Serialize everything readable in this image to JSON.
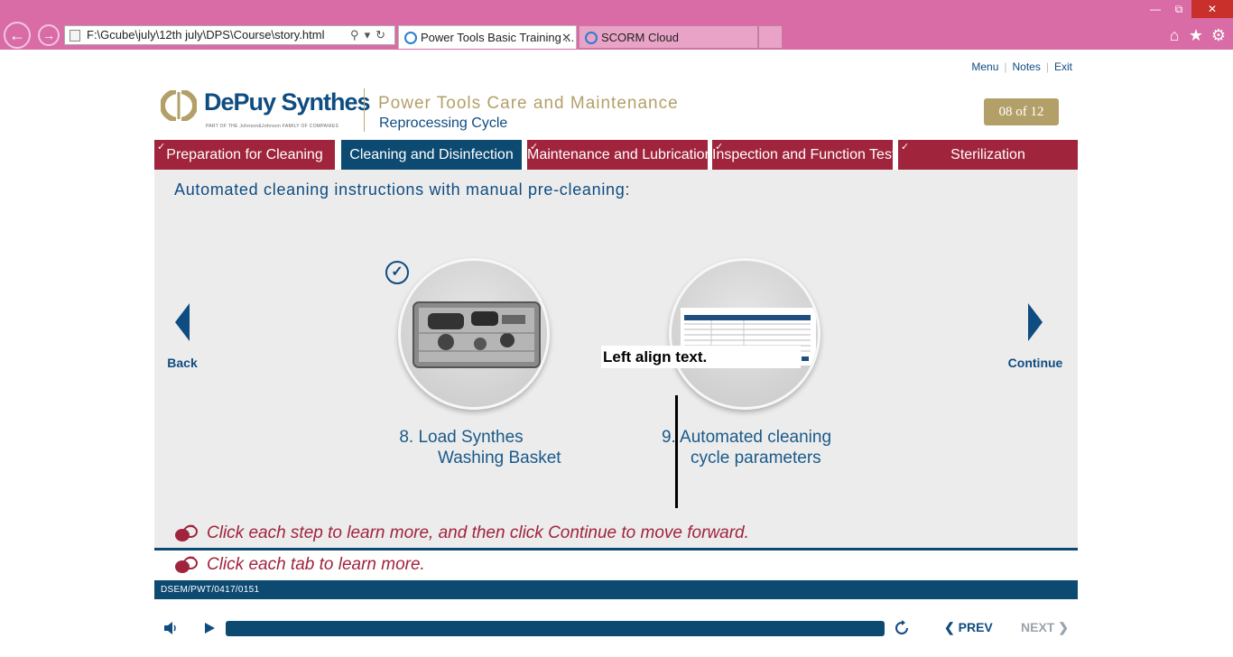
{
  "browser": {
    "address": "F:\\Gcube\\july\\12th july\\DPS\\Course\\story.html",
    "tabs": [
      {
        "label": "Power Tools Basic Training ..."
      },
      {
        "label": "SCORM Cloud"
      }
    ]
  },
  "header": {
    "links": [
      "Menu",
      "Notes",
      "Exit"
    ],
    "logo": {
      "word": "DePuy Synthes",
      "tagline": "PART OF THE Johnson&Johnson FAMILY OF COMPANIES"
    },
    "title": "Power Tools Care and Maintenance",
    "subtitle": "Reprocessing Cycle",
    "counter": "08 of 12"
  },
  "nav_tabs": [
    {
      "label": "Preparation for Cleaning",
      "checked": true
    },
    {
      "label": "Cleaning and Disinfection",
      "checked": false,
      "active": true
    },
    {
      "label": "Maintenance and Lubrication",
      "checked": true
    },
    {
      "label": "Inspection and Function Test",
      "checked": true
    },
    {
      "label": "Sterilization",
      "checked": true
    }
  ],
  "content": {
    "headline": "Automated cleaning instructions with manual pre-cleaning:",
    "back_label": "Back",
    "continue_label": "Continue",
    "steps": [
      {
        "line1": "8. Load Synthes",
        "line2": "Washing Basket",
        "completed": true
      },
      {
        "line1": "9. Automated cleaning",
        "line2": "cycle parameters",
        "completed": false
      }
    ],
    "tooltip": "Left align text."
  },
  "instructions": [
    "Click each step to learn more, and then click Continue to move forward.",
    "Click each tab to learn more."
  ],
  "footer_code": "DSEM/PWT/0417/0151",
  "player": {
    "prev_label": "PREV",
    "next_label": "NEXT",
    "progress": 1.0
  },
  "colors": {
    "brand_blue": "#0f4c81",
    "crimson": "#a0243c",
    "gold": "#b3a069",
    "chrome_pink": "#d96ca6"
  }
}
